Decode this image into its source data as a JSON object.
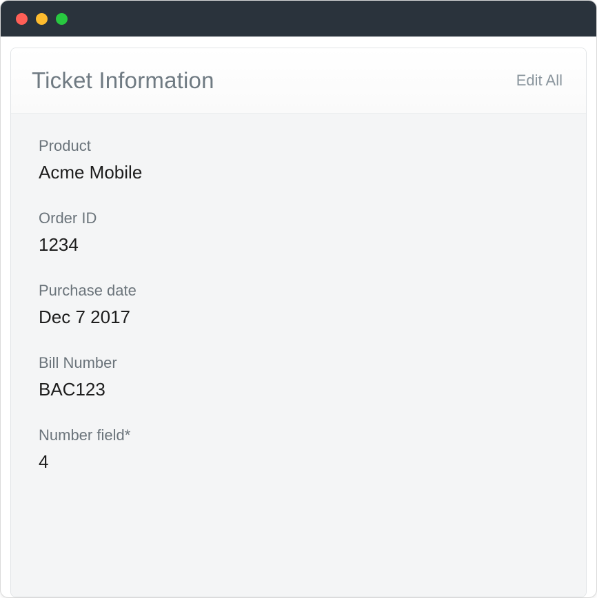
{
  "panel": {
    "title": "Ticket Information",
    "edit_all_label": "Edit All"
  },
  "fields": [
    {
      "label": "Product",
      "value": "Acme Mobile"
    },
    {
      "label": "Order ID",
      "value": "1234"
    },
    {
      "label": "Purchase date",
      "value": "Dec 7 2017"
    },
    {
      "label": "Bill Number",
      "value": "BAC123"
    },
    {
      "label": "Number field*",
      "value": "4"
    }
  ]
}
